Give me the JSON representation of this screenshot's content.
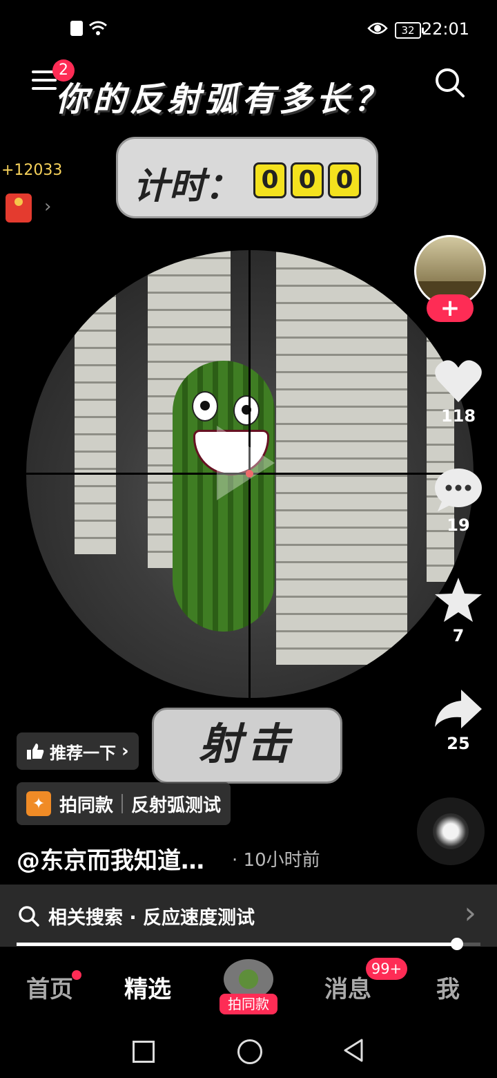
{
  "status_bar": {
    "time": "22:01",
    "battery": "32"
  },
  "top": {
    "menu_badge": "2",
    "title": "你的反射弧有多长？"
  },
  "side": {
    "coins": "+12033",
    "chevron": "›"
  },
  "timer": {
    "label": "计时：",
    "digits": [
      "0",
      "0",
      "0"
    ]
  },
  "rail": {
    "likes": "118",
    "comments": "19",
    "favorites": "7",
    "shares": "25",
    "follow": "+"
  },
  "overlay": {
    "recommend": "推荐一下",
    "shoot_button": "射击",
    "template_action": "拍同款",
    "template_name": "反射弧测试",
    "author": "@东京而我知道…",
    "time_ago": "· 10小时前"
  },
  "related": {
    "label": "相关搜索 · 反应速度测试"
  },
  "progress": {
    "fraction": 0.95
  },
  "nav": {
    "home": "首页",
    "featured": "精选",
    "create_label": "拍同款",
    "messages": "消息",
    "messages_badge": "99+",
    "me": "我"
  },
  "colors": {
    "accent": "#fe2c55",
    "timer_digit": "#f4e21e"
  }
}
